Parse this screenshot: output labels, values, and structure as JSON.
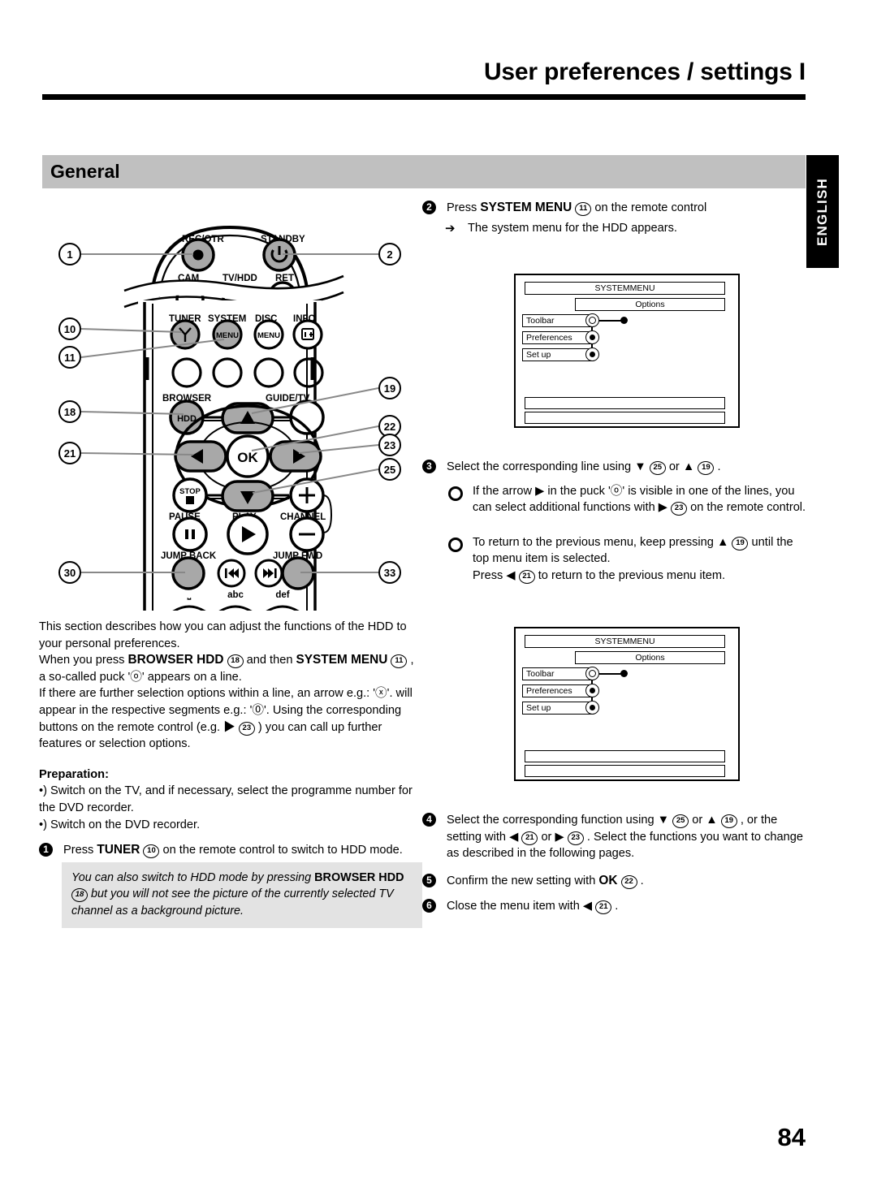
{
  "header": {
    "title": "User preferences / settings I",
    "side_tab": "ENGLISH"
  },
  "section": {
    "heading": "General"
  },
  "page_number": "84",
  "left_column": {
    "intro_p1": "This section describes how you can adjust the functions of the HDD to your personal preferences.",
    "intro_p2_a": "When you press",
    "intro_p2_b": "BROWSER HDD",
    "intro_p2_ref1": "18",
    "intro_p2_c": "and then",
    "intro_p2_d": "SYSTEM MENU",
    "intro_p2_ref2": "11",
    "intro_p2_e": ", a so-called puck 'ⓞ' appears on a line.",
    "intro_p3_a": "If there are further selection options within a line, an arrow e.g.: 'ⓧ'. will appear in the respective segments e.g.: '⓪'. Using the corresponding buttons on the remote control (e.g.",
    "intro_p3_arrow": "▶",
    "intro_p3_ref": "23",
    "intro_p3_b": ") you can call up further features or selection options.",
    "preparation_heading": "Preparation:",
    "prep_item_1": "•) Switch on the TV, and if necessary, select the programme number for the DVD recorder.",
    "prep_item_2": "•) Switch on the DVD recorder.",
    "step1_num": "1",
    "step1_a": "Press",
    "step1_b": "TUNER",
    "step1_ref": "10",
    "step1_c": "on the remote control to switch to HDD mode.",
    "note_a": "You can also switch to HDD mode by pressing",
    "note_b": "BROWSER HDD",
    "note_ref": "18",
    "note_c": "but you will not see the picture of the currently selected TV channel as a background picture."
  },
  "right_column": {
    "step2_num": "2",
    "step2_a": "Press",
    "step2_b": "SYSTEM MENU",
    "step2_ref": "11",
    "step2_c": "on the remote control",
    "step2_arrow_text": "The system menu for the HDD appears.",
    "step3_num": "3",
    "step3_a": "Select the corresponding line using",
    "step3_down": "▼",
    "step3_ref1": "25",
    "step3_or": "or",
    "step3_up": "▲",
    "step3_ref2": "19",
    "step3_end": ".",
    "step3_sub1_a": "If the arrow",
    "step3_sub1_arrow": "▶",
    "step3_sub1_b": "in the puck 'ⓞ' is visible in one of the lines, you can select additional functions with",
    "step3_sub1_arrow2": "▶",
    "step3_sub1_ref": "23",
    "step3_sub1_c": "on the remote control.",
    "step3_sub2_a": "To return to the previous menu, keep pressing",
    "step3_sub2_up": "▲",
    "step3_sub2_ref": "19",
    "step3_sub2_b": "until the top menu item is selected.",
    "step3_sub2_c": "Press",
    "step3_sub2_left": "◀",
    "step3_sub2_ref2": "21",
    "step3_sub2_d": "to return to the previous menu item.",
    "step4_num": "4",
    "step4_a": "Select the corresponding function using",
    "step4_down": "▼",
    "step4_ref1": "25",
    "step4_or1": "or",
    "step4_up": "▲",
    "step4_ref2": "19",
    "step4_b": ", or the setting with",
    "step4_left": "◀",
    "step4_ref3": "21",
    "step4_or2": "or",
    "step4_right": "▶",
    "step4_ref4": "23",
    "step4_c": ". Select the functions you want to change as described in the following pages.",
    "step5_num": "5",
    "step5_a": "Confirm the new setting with",
    "step5_b": "OK",
    "step5_ref": "22",
    "step5_c": ".",
    "step6_num": "6",
    "step6_a": "Close the menu item with",
    "step6_left": "◀",
    "step6_ref": "21",
    "step6_c": "."
  },
  "osd_menu": {
    "title": "SYSTEMMENU",
    "options_label": "Options",
    "rows": [
      {
        "label": "Toolbar",
        "selected": true
      },
      {
        "label": "Preferences",
        "selected": false
      },
      {
        "label": "Set up",
        "selected": false
      }
    ]
  },
  "remote": {
    "labels": {
      "rec_otr": "REC/OTR",
      "standby": "STANDBY",
      "cam": "CAM",
      "tv_hdd": "TV/HDD",
      "ret": "RET",
      "tuner": "TUNER",
      "system": "SYSTEM",
      "disc": "DISC",
      "info": "INFO",
      "menu": "MENU",
      "browser": "BROWSER",
      "hdd": "HDD",
      "guide_tv": "GUIDE/TV",
      "ok": "OK",
      "stop": "STOP",
      "pause": "PAUSE",
      "play": "PLAY",
      "channel": "CHANNEL",
      "jump_back": "JUMP BACK",
      "jump_fwd": "JUMP FWD",
      "key_space": "␣",
      "key_abc": "abc",
      "key_def": "def"
    },
    "callouts_left": [
      "1",
      "10",
      "11",
      "18",
      "21",
      "30"
    ],
    "callouts_right": [
      "2",
      "19",
      "22",
      "23",
      "25",
      "33"
    ]
  },
  "colors": {
    "accent_bar": "#c0c0c0",
    "note_bg": "#e3e3e3",
    "button_fill": "#a8a8a8",
    "ink": "#000000"
  }
}
